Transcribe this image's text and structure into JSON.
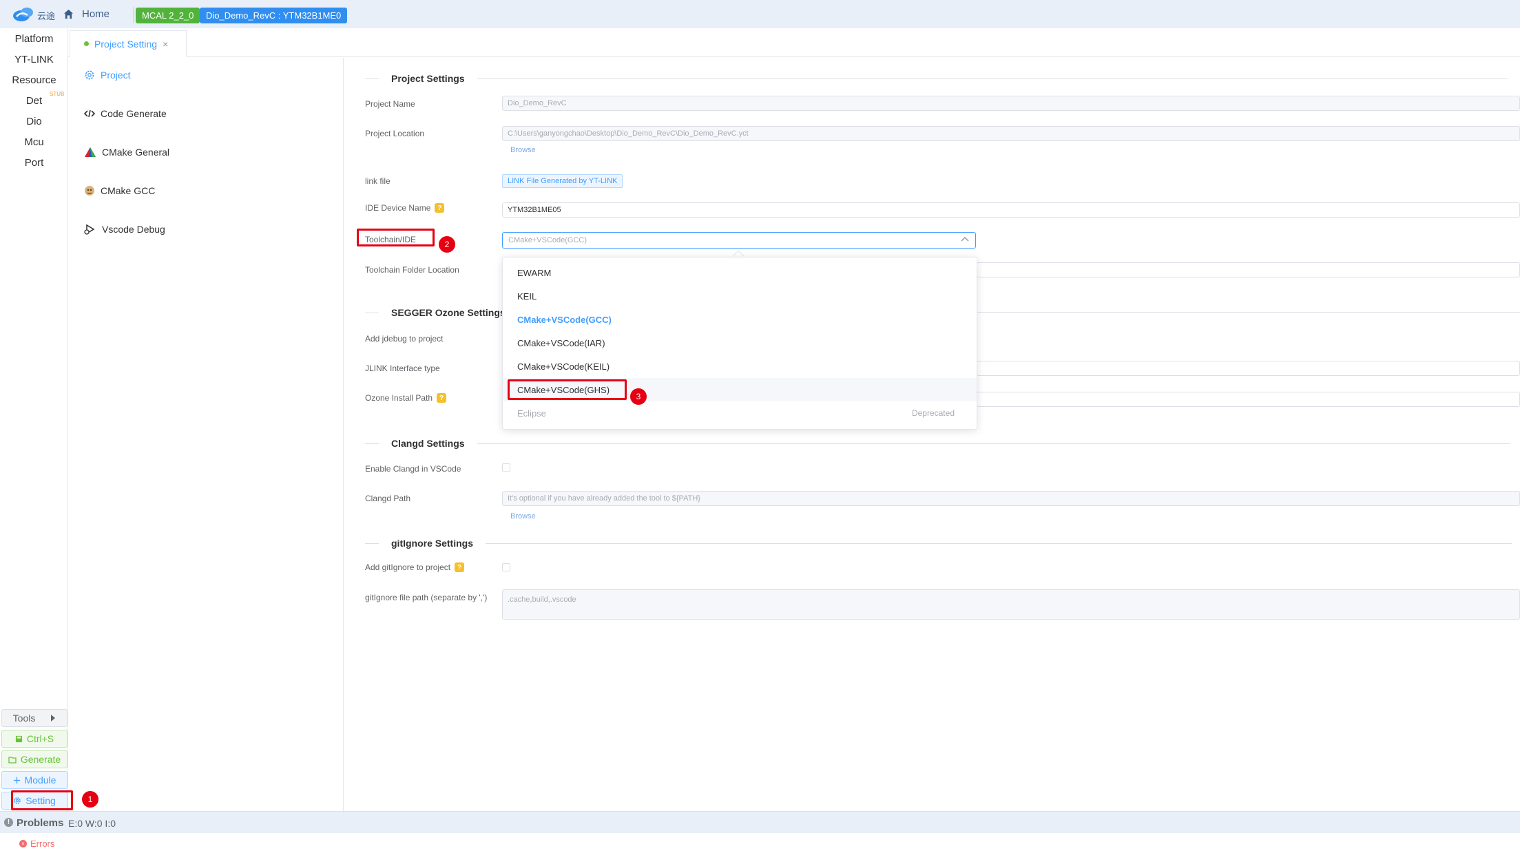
{
  "topbar": {
    "logo_text": "云途",
    "home_label": "Home",
    "mcal_badge": "MCAL 2_2_0",
    "project_badge": "Dio_Demo_RevC : YTM32B1ME0"
  },
  "left_nav": {
    "items": [
      "Platform",
      "YT-LINK",
      "Resource",
      "Det",
      "Dio",
      "Mcu",
      "Port"
    ],
    "stub_tag": "STUB",
    "tools_label": "Tools",
    "save_label": "Ctrl+S",
    "generate_label": "Generate",
    "module_label": "Module",
    "setting_label": "Setting"
  },
  "tab": {
    "label": "Project Setting",
    "close": "×"
  },
  "settings_side": {
    "items": [
      "Project",
      "Code Generate",
      "CMake General",
      "CMake GCC",
      "Vscode Debug"
    ]
  },
  "form": {
    "project_section": "Project Settings",
    "project_name_label": "Project Name",
    "project_name_value": "Dio_Demo_RevC",
    "project_location_label": "Project Location",
    "project_location_value": "C:\\Users\\ganyongchao\\Desktop\\Dio_Demo_RevC\\Dio_Demo_RevC.yct",
    "browse_label": "Browse",
    "link_file_label": "link file",
    "link_file_value": "LINK File Generated by YT-LINK",
    "ide_device_label": "IDE Device Name",
    "ide_device_value": "YTM32B1ME05",
    "toolchain_label": "Toolchain/IDE",
    "toolchain_value": "CMake+VSCode(GCC)",
    "toolchain_folder_label": "Toolchain Folder Location",
    "segger_section": "SEGGER Ozone Settings",
    "add_jdebug_label": "Add jdebug to project",
    "jlink_label": "JLINK Interface type",
    "ozone_path_label": "Ozone Install Path",
    "clangd_section": "Clangd Settings",
    "enable_clangd_label": "Enable Clangd in VSCode",
    "clangd_path_label": "Clangd Path",
    "clangd_path_placeholder": "It's optional if you have already added the tool to ${PATH}",
    "gitignore_section": "gitIgnore Settings",
    "add_gitignore_label": "Add gitIgnore to project",
    "gitignore_path_label": "gitIgnore file path (separate by ',')",
    "gitignore_path_placeholder": ".cache,build,.vscode",
    "q_mark": "?"
  },
  "dropdown": {
    "options": [
      "EWARM",
      "KEIL",
      "CMake+VSCode(GCC)",
      "CMake+VSCode(IAR)",
      "CMake+VSCode(KEIL)",
      "CMake+VSCode(GHS)",
      "Eclipse"
    ],
    "deprecated_note": "Deprecated",
    "selected_index": 2,
    "hovered_index": 5,
    "disabled_index": 6
  },
  "problems": {
    "title": "Problems",
    "counts": "E:0 W:0 I:0",
    "errors_tab": "Errors"
  },
  "annotations": [
    "1",
    "2",
    "3"
  ],
  "colors": {
    "accent": "#409eff",
    "success": "#67c23a",
    "annotation": "#e60012"
  }
}
